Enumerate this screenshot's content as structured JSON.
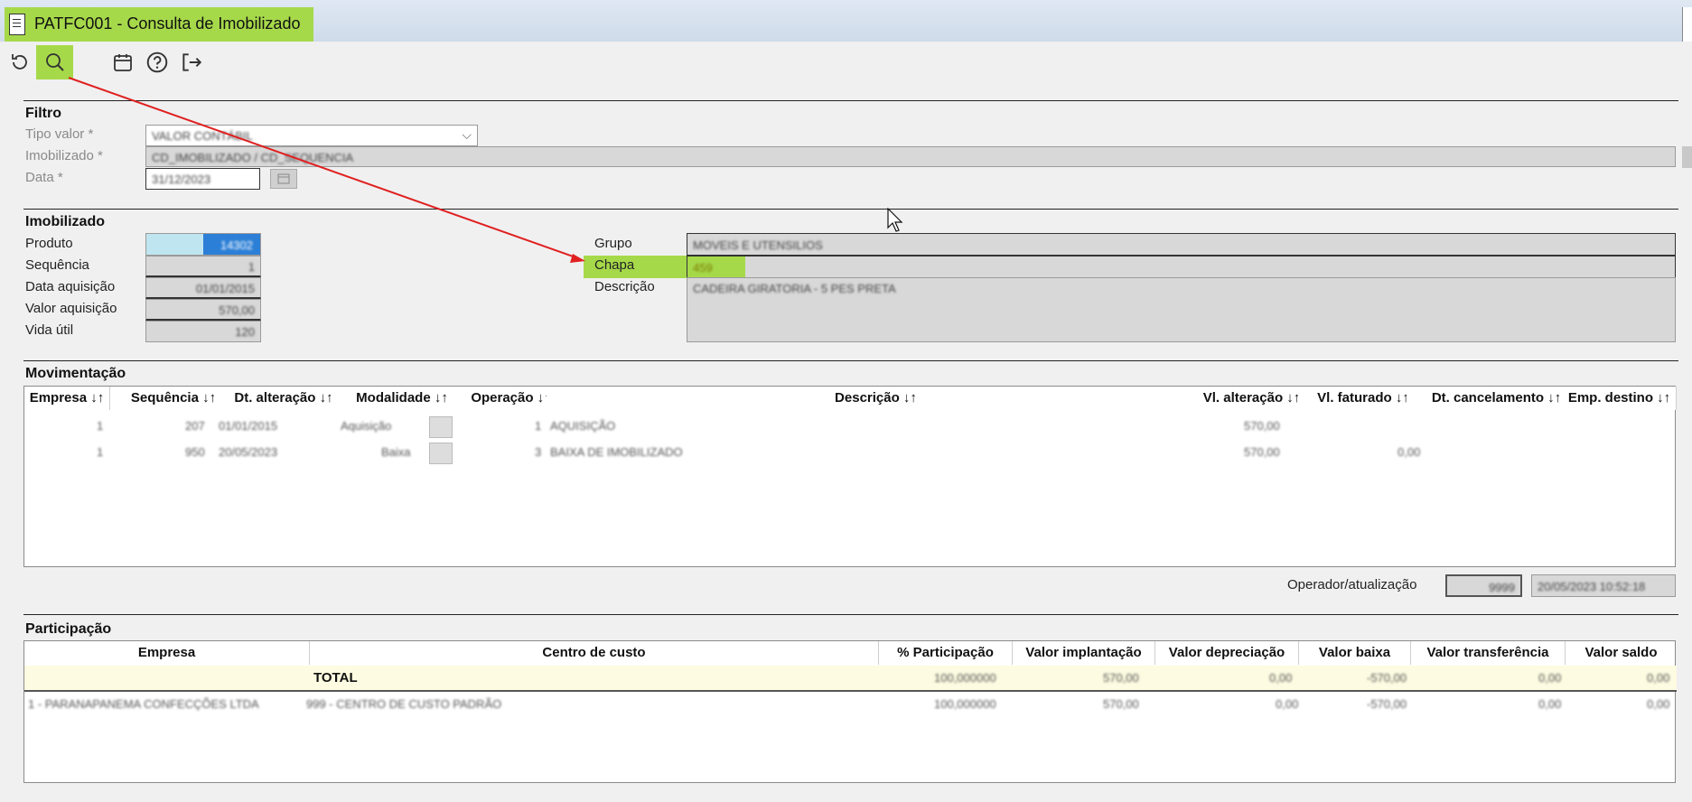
{
  "window": {
    "title": "PATFC001 - Consulta de Imobilizado"
  },
  "toolbar": {
    "icons": [
      "refresh-icon",
      "search-icon",
      "calendar-icon",
      "help-icon",
      "exit-icon"
    ]
  },
  "filtro": {
    "title": "Filtro",
    "tipo_valor_label": "Tipo valor *",
    "tipo_valor_value": "VALOR CONTÁBIL",
    "imobilizado_label": "Imobilizado *",
    "imobilizado_value": "CD_IMOBILIZADO / CD_SEQUENCIA",
    "data_label": "Data *",
    "data_value": "31/12/2023"
  },
  "imobilizado": {
    "title": "Imobilizado",
    "produto_label": "Produto",
    "produto_value": "14302",
    "sequencia_label": "Sequência",
    "sequencia_value": "1",
    "data_aquisicao_label": "Data aquisição",
    "data_aquisicao_value": "01/01/2015",
    "valor_aquisicao_label": "Valor aquisição",
    "valor_aquisicao_value": "570,00",
    "vida_util_label": "Vida útil",
    "vida_util_value": "120",
    "grupo_label": "Grupo",
    "grupo_value": "MOVEIS E UTENSILIOS",
    "chapa_label": "Chapa",
    "chapa_value": "459",
    "descricao_label": "Descrição",
    "descricao_value": "CADEIRA GIRATORIA - 5 PES PRETA"
  },
  "movimentacao": {
    "title": "Movimentação",
    "columns": [
      "Empresa ↓↑",
      "Sequência ↓↑",
      "Dt. alteração ↓↑",
      "Modalidade ↓↑",
      "Operação ↓↑",
      "Descrição ↓↑",
      "Vl. alteração ↓↑",
      "Vl. faturado ↓↑",
      "Dt. cancelamento ↓↑",
      "Emp. destino ↓↑"
    ],
    "rows": [
      {
        "empresa": "1",
        "sequencia": "207",
        "dt_alteracao": "01/01/2015",
        "modalidade": "Aquisição",
        "operacao": "1",
        "descricao": "AQUISIÇÃO",
        "vl_alteracao": "570,00",
        "vl_faturado": ""
      },
      {
        "empresa": "1",
        "sequencia": "950",
        "dt_alteracao": "20/05/2023",
        "modalidade": "Baixa",
        "operacao": "3",
        "descricao": "BAIXA DE IMOBILIZADO",
        "vl_alteracao": "570,00",
        "vl_faturado": "0,00"
      }
    ],
    "operador_label": "Operador/atualização",
    "operador_value": "9999",
    "atualizacao_value": "20/05/2023 10:52:18"
  },
  "participacao": {
    "title": "Participação",
    "columns": [
      "Empresa",
      "Centro de custo",
      "% Participação",
      "Valor implantação",
      "Valor depreciação",
      "Valor baixa",
      "Valor transferência",
      "Valor saldo"
    ],
    "total": {
      "label": "TOTAL",
      "participacao": "100,000000",
      "implantacao": "570,00",
      "depreciacao": "0,00",
      "baixa": "-570,00",
      "transferencia": "0,00",
      "saldo": "0,00"
    },
    "rows": [
      {
        "empresa": "1 - PARANAPANEMA CONFECÇÕES LTDA",
        "centro": "999 - CENTRO DE CUSTO PADRÃO",
        "participacao": "100,000000",
        "implantacao": "570,00",
        "depreciacao": "0,00",
        "baixa": "-570,00",
        "transferencia": "0,00",
        "saldo": "0,00"
      }
    ]
  }
}
